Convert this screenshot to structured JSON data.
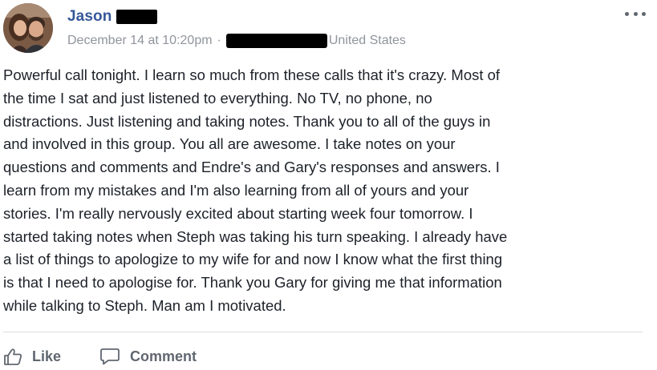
{
  "post": {
    "author_name": "Jason",
    "timestamp": "December 14 at 10:20pm",
    "separator": "·",
    "location": "United States",
    "body": "Powerful call tonight. I learn so much from these calls that it's crazy. Most of\nthe time I sat and just listened to everything. No TV, no phone, no\ndistractions. Just listening and taking notes. Thank you to all of the guys in\nand involved in this group. You all are awesome. I take notes on your\nquestions and comments and Endre's and Gary's responses and answers. I\nlearn from my mistakes and I'm also learning from all of yours and your\nstories. I'm really nervously excited about starting week four tomorrow. I\nstarted taking notes when Steph was taking his turn speaking. I already have\na list of things to apologize to my wife for and now I know what the first thing\nis that I need to apologise for. Thank you Gary for giving me that information\nwhile talking to Steph. Man am I motivated."
  },
  "actions": {
    "like_label": "Like",
    "comment_label": "Comment"
  },
  "icons": {
    "more": "more-options-icon",
    "like": "thumbs-up-icon",
    "comment": "speech-bubble-icon"
  },
  "colors": {
    "author_link": "#365899",
    "meta_text": "#90949c",
    "body_text": "#1d2129",
    "action_text": "#606770",
    "divider": "#dadde1"
  }
}
